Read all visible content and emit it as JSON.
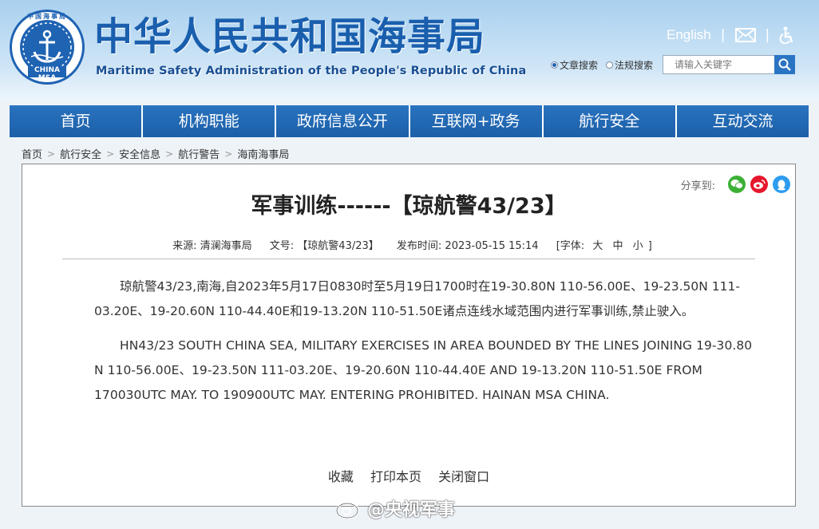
{
  "header": {
    "logo_text_top": "中国海事局",
    "logo_text_bottom": "CHINA MSA",
    "title": "中华人民共和国海事局",
    "subtitle": "Maritime Safety Administration of the People's Republic of China",
    "english_link": "English",
    "search": {
      "option1": "文章搜索",
      "option2": "法规搜索",
      "placeholder": "请输入关键字"
    }
  },
  "nav": {
    "items": [
      {
        "label": "首页"
      },
      {
        "label": "机构职能"
      },
      {
        "label": "政府信息公开"
      },
      {
        "label": "互联网+政务"
      },
      {
        "label": "航行安全"
      },
      {
        "label": "互动交流"
      }
    ]
  },
  "breadcrumb": [
    "首页",
    "航行安全",
    "安全信息",
    "航行警告",
    "海南海事局"
  ],
  "share": {
    "label": "分享到:",
    "icons": [
      "wechat-icon",
      "weibo-icon",
      "qq-icon"
    ]
  },
  "article": {
    "title": "军事训练------【琼航警43/23】",
    "meta": {
      "source": "来源: 清澜海事局",
      "doc_no": "文号: 【琼航警43/23】",
      "time": "发布时间: 2023-05-15 15:14",
      "font_label": "[字体:",
      "font_large": "大",
      "font_medium": "中",
      "font_small": "小",
      "font_close": "]"
    },
    "paragraph_cn": "琼航警43/23,南海,自2023年5月17日0830时至5月19日1700时在19-30.80N 110-56.00E、19-23.50N 111-03.20E、19-20.60N 110-44.40E和19-13.20N 110-51.50E诸点连线水域范围内进行军事训练,禁止驶入。",
    "paragraph_en": "HN43/23 SOUTH CHINA SEA, MILITARY EXERCISES IN AREA BOUNDED BY THE LINES JOINING 19-30.80 N 110-56.00E、19-23.50N 111-03.20E、19-20.60N 110-44.40E AND 19-13.20N 110-51.50E FROM 170030UTC MAY. TO 190900UTC MAY. ENTERING PROHIBITED. HAINAN MSA CHINA."
  },
  "actions": {
    "favorite": "收藏",
    "print": "打印本页",
    "close": "关闭窗口"
  },
  "watermark": {
    "text": "@央视军事"
  },
  "colors": {
    "brand_blue": "#1a5fae",
    "nav_blue": "#1b5fa8",
    "wechat_green": "#3cb034",
    "weibo_red": "#e6162d",
    "qq_blue": "#2c9cf0"
  }
}
